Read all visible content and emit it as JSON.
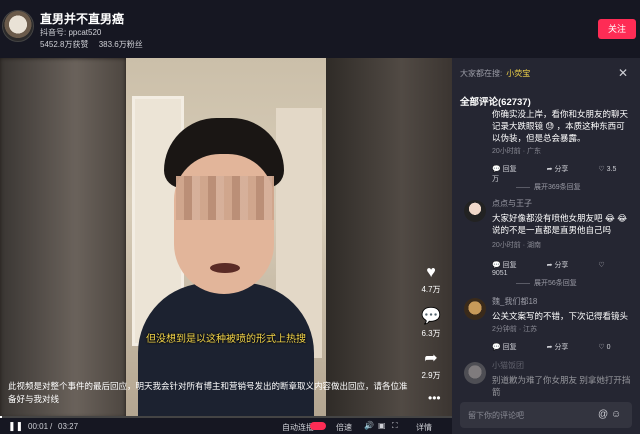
{
  "header": {
    "title": "直男并不直男癌",
    "douyin_id": "抖音号: ppcat520",
    "likes": "5452.8万获赞",
    "fans": "383.6万粉丝",
    "follow_label": "关注"
  },
  "video": {
    "subtitle": "但没想到是以这种被喷的形式上热搜",
    "description": "此视频是对整个事件的最后回应，明天我会针对所有博主和营销号发出的断章取义内容做出回应，请各位准备好与我对线",
    "more": "•••",
    "likes": "4.7万",
    "comments": "6.3万",
    "shares": "2.9万"
  },
  "controls": {
    "current_time": "00:01",
    "separator": "/",
    "total_time": "03:27",
    "progress": 0.005,
    "autoplay_label": "自动连播",
    "speed_label": "倍速",
    "details_label": "详情"
  },
  "panel": {
    "search_hint": "大家都在搜:",
    "search_keyword": "小荧宝",
    "all_comments": "全部评论(62737)",
    "comments": [
      {
        "name": "",
        "text": "你确实没上岸，看你和女朋友的聊天记录大跌眼镜 😓 ，本质这种东西可以伪装，但是总会暴露。",
        "meta": "20小时前 · 广东",
        "reply": "回复",
        "share": "分享",
        "likes": "3.5万",
        "expand": "展开369条回复"
      },
      {
        "name": "点点与王子",
        "text": "大家好像都没有喷他女朋友吧 😂 😂 说的不是一直都是直男他自己吗",
        "meta": "20小时前 · 湖南",
        "reply": "回复",
        "share": "分享",
        "likes": "9051",
        "expand": "展开56条回复"
      },
      {
        "name": "魏_我们都18",
        "text": "公关文案写的不错，下次记得看镜头",
        "meta": "2分钟前 · 江苏",
        "reply": "回复",
        "share": "分享",
        "likes": "0",
        "expand": ""
      },
      {
        "name": "小猫饭团",
        "text": "别道歉为难了你女朋友 别拿她打开挡箭",
        "meta": "",
        "reply": "",
        "share": "",
        "likes": "",
        "expand": ""
      }
    ],
    "input_placeholder": "留下你的评论吧"
  }
}
